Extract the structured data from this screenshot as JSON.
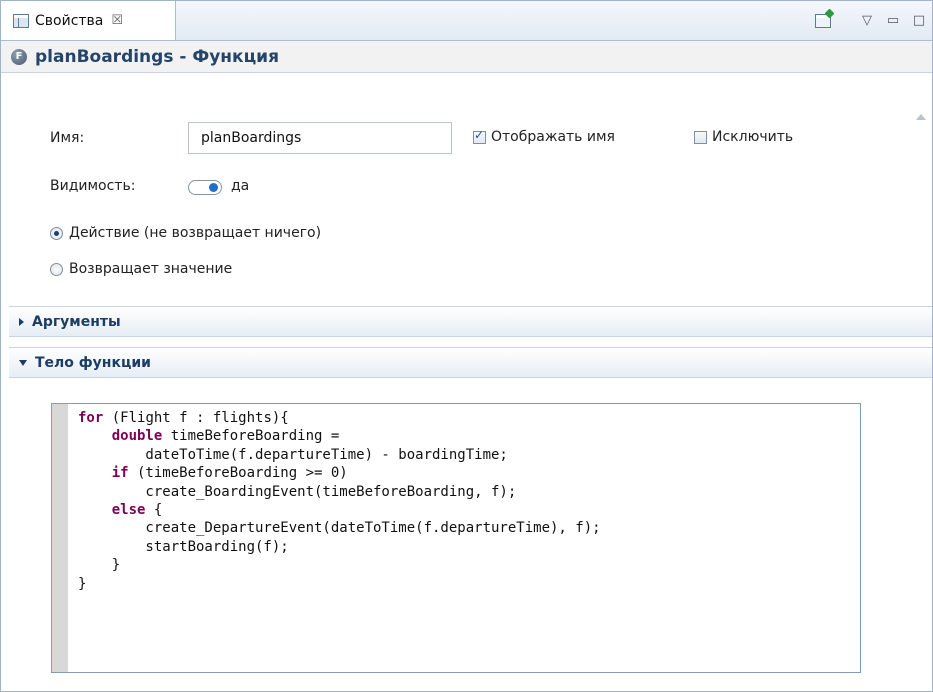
{
  "tab": {
    "label": "Свойства",
    "close_symbol": "☒"
  },
  "view_menu_symbol": "▽",
  "minimize_symbol": "▭",
  "maximize_symbol": "□",
  "header": {
    "title": "planBoardings - Функция",
    "icon_letter": "F"
  },
  "form": {
    "name_label": "Имя:",
    "name_value": "planBoardings",
    "show_name_label": "Отображать имя",
    "show_name_checked": true,
    "exclude_label": "Исключить",
    "exclude_checked": false,
    "visibility_label": "Видимость:",
    "visibility_value": "да",
    "radio_action": "Действие (не возвращает ничего)",
    "radio_returns": "Возвращает значение",
    "selected_radio": "action"
  },
  "sections": {
    "arguments": "Аргументы",
    "body": "Тело функции"
  },
  "code_lines": [
    "for (Flight f : flights){",
    "    double timeBeforeBoarding =",
    "        dateToTime(f.departureTime) - boardingTime;",
    "    if (timeBeforeBoarding >= 0)",
    "        create_BoardingEvent(timeBeforeBoarding, f);",
    "    else {",
    "        create_DepartureEvent(dateToTime(f.departureTime), f);",
    "        startBoarding(f);",
    "    }",
    "}"
  ],
  "code_keywords": [
    "for",
    "double",
    "if",
    "else"
  ]
}
